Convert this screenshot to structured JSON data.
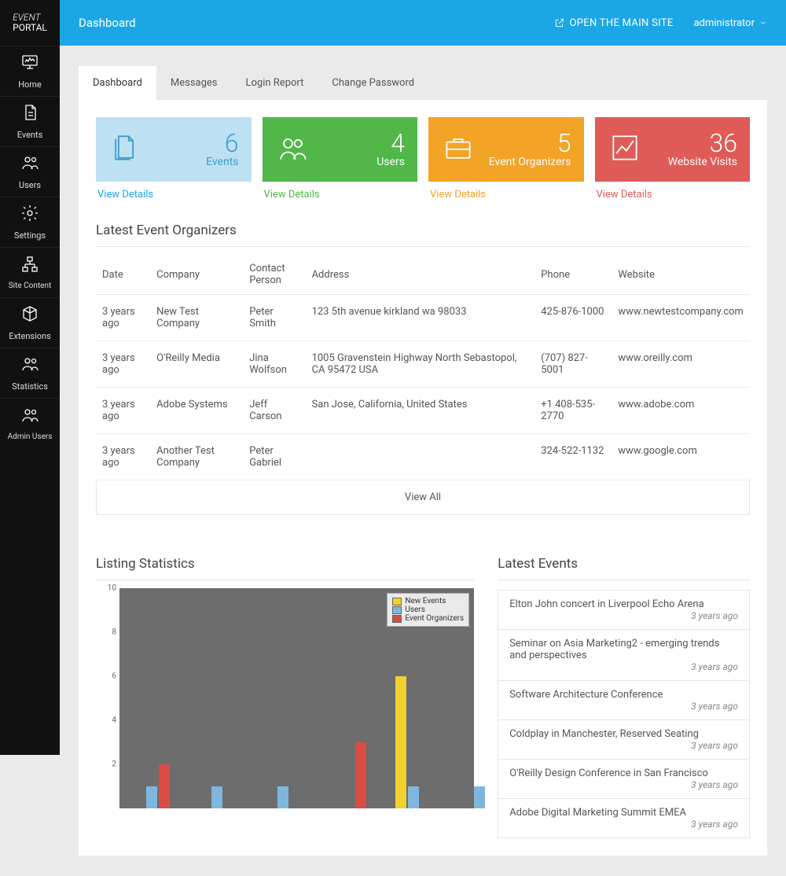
{
  "brand_line1": "EVENT",
  "brand_line2": "PORTAL",
  "nav": [
    {
      "label": "Home"
    },
    {
      "label": "Events"
    },
    {
      "label": "Users"
    },
    {
      "label": "Settings"
    },
    {
      "label": "Site Content"
    },
    {
      "label": "Extensions"
    },
    {
      "label": "Statistics"
    },
    {
      "label": "Admin Users"
    }
  ],
  "topbar": {
    "title": "Dashboard",
    "open_main": "OPEN THE MAIN SITE",
    "user": "administrator"
  },
  "tabs": [
    "Dashboard",
    "Messages",
    "Login Report",
    "Change Password"
  ],
  "cards": [
    {
      "num": "6",
      "label": "Events",
      "link": "View Details"
    },
    {
      "num": "4",
      "label": "Users",
      "link": "View Details"
    },
    {
      "num": "5",
      "label": "Event Organizers",
      "link": "View Details"
    },
    {
      "num": "36",
      "label": "Website Visits",
      "link": "View Details"
    }
  ],
  "organizers": {
    "title": "Latest Event Organizers",
    "headers": {
      "date": "Date",
      "company": "Company",
      "person": "Contact Person",
      "address": "Address",
      "phone": "Phone",
      "website": "Website"
    },
    "rows": [
      {
        "date": "3 years ago",
        "company": "New Test Company",
        "person": "Peter Smith",
        "address": "123 5th avenue kirkland wa 98033",
        "phone": "425-876-1000",
        "website": "www.newtestcompany.com"
      },
      {
        "date": "3 years ago",
        "company": "O'Reilly Media",
        "person": "Jina Wolfson",
        "address": "1005 Gravenstein Highway North Sebastopol, CA 95472 USA",
        "phone": "(707) 827-5001",
        "website": "www.oreilly.com"
      },
      {
        "date": "3 years ago",
        "company": "Adobe Systems",
        "person": "Jeff Carson",
        "address": "San Jose, California, United States",
        "phone": "+1 408-535-2770",
        "website": "www.adobe.com"
      },
      {
        "date": "3 years ago",
        "company": "Another Test Company",
        "person": "Peter Gabriel",
        "address": "",
        "phone": "324-522-1132",
        "website": "www.google.com"
      }
    ],
    "view_all": "View All"
  },
  "stats_title": "Listing Statistics",
  "latest_events_title": "Latest Events",
  "latest_events": [
    {
      "title": "Elton John concert in Liverpool Echo Arena",
      "ago": "3 years ago"
    },
    {
      "title": "Seminar on Asia Marketing2 - emerging trends and perspectives",
      "ago": "3 years ago"
    },
    {
      "title": "Software Architecture Conference",
      "ago": "3 years ago"
    },
    {
      "title": "Coldplay in Manchester, Reserved Seating",
      "ago": "3 years ago"
    },
    {
      "title": "O'Reilly Design Conference in San Francisco",
      "ago": "3 years ago"
    },
    {
      "title": "Adobe Digital Marketing Summit EMEA",
      "ago": "3 years ago"
    }
  ],
  "chart_data": {
    "type": "bar",
    "yticks": [
      2,
      4,
      6,
      8,
      10
    ],
    "ylim": [
      0,
      10
    ],
    "legend": [
      "New Events",
      "Users",
      "Event Organizers"
    ],
    "groups": 6,
    "series": [
      {
        "name": "New Events",
        "color": "#f2d22e",
        "values": [
          0,
          0,
          0,
          0,
          6,
          0
        ]
      },
      {
        "name": "Users",
        "color": "#7fb6e0",
        "values": [
          1,
          1,
          1,
          0,
          1,
          1
        ]
      },
      {
        "name": "Event Organizers",
        "color": "#d94c43",
        "values": [
          2,
          0,
          0,
          3,
          0,
          0
        ]
      }
    ]
  }
}
